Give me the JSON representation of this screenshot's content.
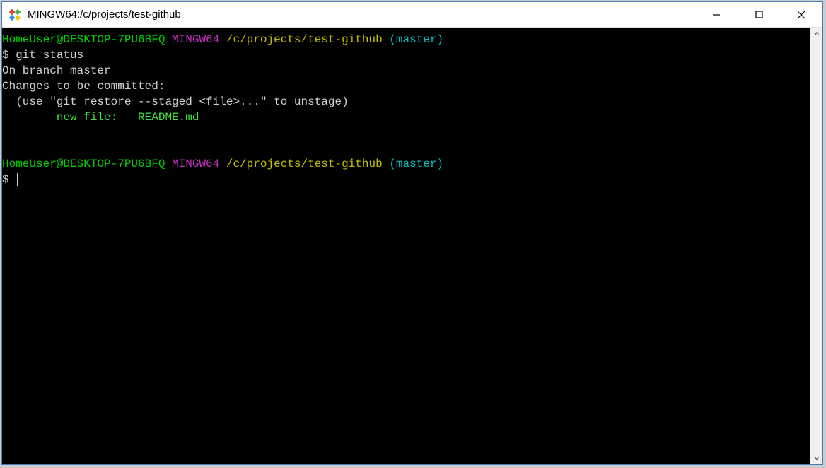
{
  "window": {
    "title": "MINGW64:/c/projects/test-github"
  },
  "terminal": {
    "prompt1": {
      "userhost": "HomeUser@DESKTOP-7PU6BFQ",
      "env": "MINGW64",
      "path": "/c/projects/test-github",
      "branch": "(master)"
    },
    "command1": "$ git status",
    "output": {
      "line1": "On branch master",
      "line2": "Changes to be committed:",
      "line3": "  (use \"git restore --staged <file>...\" to unstage)",
      "line4_label": "        new file:   ",
      "line4_file": "README.md"
    },
    "prompt2": {
      "userhost": "HomeUser@DESKTOP-7PU6BFQ",
      "env": "MINGW64",
      "path": "/c/projects/test-github",
      "branch": "(master)"
    },
    "command2_prefix": "$ "
  }
}
